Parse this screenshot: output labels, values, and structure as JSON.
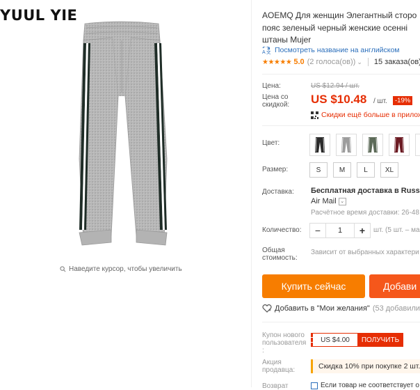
{
  "brand": "YUUL YIE",
  "gallery": {
    "zoom_hint": "Наведите курсор, чтобы увеличить"
  },
  "product": {
    "title_lines": [
      "AOEMQ Для женщин Элегантный сторо",
      "пояс зеленый черный женские осенні",
      "штаны Mujer"
    ],
    "translate_link": "Посмотреть название на английском",
    "rating": {
      "stars": "★★★★★",
      "score": "5.0",
      "votes": "(2 голоса(ов))",
      "orders": "15 заказа(ов)"
    }
  },
  "price": {
    "label": "Цена:",
    "old": "US $12.94 / шт.",
    "discount_label_1": "Цена со",
    "discount_label_2": "скидкой:",
    "new": "US $10.48",
    "per": "/ шт.",
    "discount": "-19%",
    "app_promo": "Скидки ещё больше в прилож"
  },
  "options": {
    "color_label": "Цвет:",
    "colors": [
      {
        "name": "black",
        "hex": "#2a2a2a"
      },
      {
        "name": "grey",
        "hex": "#9c9c9c"
      },
      {
        "name": "green",
        "hex": "#5c6a58"
      },
      {
        "name": "wine",
        "hex": "#6b1a22"
      },
      {
        "name": "blue",
        "hex": "#5b7390"
      }
    ],
    "size_label": "Размер:",
    "sizes": [
      "S",
      "M",
      "L",
      "XL"
    ]
  },
  "shipping": {
    "label": "Доставка:",
    "line1": "Бесплатная доставка в Russian",
    "line2": "Air Mail",
    "line3": "Расчётное время доставки: 26-48"
  },
  "quantity": {
    "label": "Количество:",
    "minus": "−",
    "value": "1",
    "plus": "+",
    "available": "шт. (5 шт. – ма"
  },
  "total": {
    "label_1": "Общая",
    "label_2": "стоимость:",
    "value": "Зависит от выбранных характери"
  },
  "actions": {
    "buy": "Купить сейчас",
    "cart": "Добави",
    "wishlist": "Добавить в \"Мои желания\"",
    "wishlist_count": "(53 добавили)"
  },
  "coupon": {
    "label_1": "Купон нового",
    "label_2": "пользователя",
    "label_3": ":",
    "value": "US $4.00",
    "button": "ПОЛУЧИТЬ"
  },
  "seller_promo": {
    "label_1": "Акция",
    "label_2": "продавца:",
    "text": "Скидка 10% при покупке 2 шт."
  },
  "return": {
    "label": "Возврат",
    "text": "Если товар не соответствует о"
  }
}
